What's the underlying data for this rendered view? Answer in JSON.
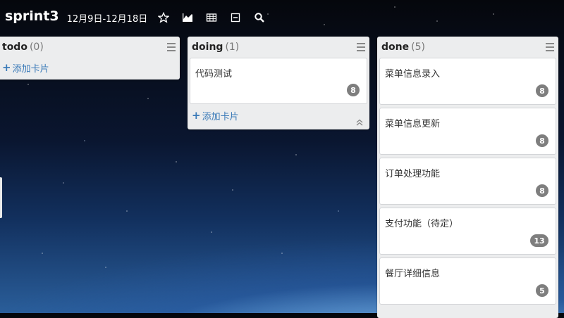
{
  "board": {
    "title": "sprint3",
    "dates": "12月9日-12月18日",
    "toolbar_icons": [
      "star-icon",
      "chart-icon",
      "table-icon",
      "minimize-icon",
      "search-icon"
    ]
  },
  "lists": [
    {
      "name": "todo",
      "count": "(0)",
      "add_label": "添加卡片",
      "cards": []
    },
    {
      "name": "doing",
      "count": "(1)",
      "add_label": "添加卡片",
      "cards": [
        {
          "title": "代码测试",
          "points": "8"
        }
      ]
    },
    {
      "name": "done",
      "count": "(5)",
      "cards": [
        {
          "title": "菜单信息录入",
          "points": "8"
        },
        {
          "title": "菜单信息更新",
          "points": "8"
        },
        {
          "title": "订单处理功能",
          "points": "8"
        },
        {
          "title": "支付功能（待定）",
          "points": "13"
        },
        {
          "title": "餐厅详细信息",
          "points": "5"
        }
      ]
    }
  ]
}
